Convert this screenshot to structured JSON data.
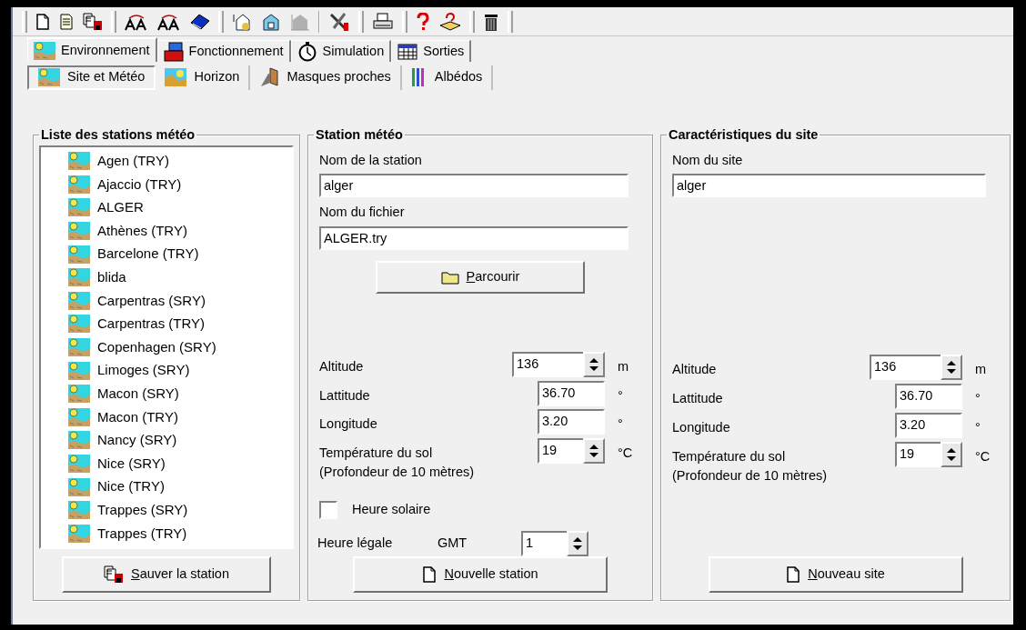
{
  "tabs": [
    {
      "label": "Environnement",
      "selected": true
    },
    {
      "label": "Fonctionnement",
      "selected": false
    },
    {
      "label": "Simulation",
      "selected": false
    },
    {
      "label": "Sorties",
      "selected": false
    }
  ],
  "subtabs": [
    {
      "label": "Site et Météo",
      "selected": true
    },
    {
      "label": "Horizon",
      "selected": false
    },
    {
      "label": "Masques proches",
      "selected": false
    },
    {
      "label": "Albédos",
      "selected": false
    }
  ],
  "stations_panel": {
    "title": "Liste des stations météo",
    "items": [
      {
        "label": "Agen (TRY)"
      },
      {
        "label": "Ajaccio (TRY)"
      },
      {
        "label": "ALGER"
      },
      {
        "label": "Athènes (TRY)"
      },
      {
        "label": "Barcelone (TRY)"
      },
      {
        "label": "blida"
      },
      {
        "label": "Carpentras (SRY)"
      },
      {
        "label": "Carpentras (TRY)"
      },
      {
        "label": "Copenhagen (SRY)"
      },
      {
        "label": "Limoges (SRY)"
      },
      {
        "label": "Macon (SRY)"
      },
      {
        "label": "Macon (TRY)"
      },
      {
        "label": "Nancy (SRY)"
      },
      {
        "label": "Nice (SRY)"
      },
      {
        "label": "Nice (TRY)"
      },
      {
        "label": "Trappes (SRY)"
      },
      {
        "label": "Trappes (TRY)"
      }
    ],
    "button": {
      "label": "Sauver la station"
    }
  },
  "station_panel": {
    "title": "Station météo",
    "fields": [
      {
        "label": "Nom de la station",
        "value": "alger"
      },
      {
        "label": "Nom du fichier",
        "value": "ALGER.try"
      }
    ],
    "browse_button": {
      "label": "Parcourir"
    },
    "params": [
      {
        "kind": "wide_spin",
        "label": "Altitude",
        "value": "136",
        "unit": "m"
      },
      {
        "kind": "field",
        "label": "Lattitude",
        "value": "36.70",
        "unit": "°"
      },
      {
        "kind": "field",
        "label": "Longitude",
        "value": "3.20",
        "unit": "°"
      },
      {
        "kind": "spin",
        "label": "Température du sol",
        "sublabel": "(Profondeur de 10 mètres)",
        "value": "19",
        "unit": "°C"
      }
    ],
    "solar_time": {
      "label": "Heure solaire",
      "checked": false
    },
    "legal_time": {
      "label": "Heure légale",
      "zone": "GMT",
      "value": "1"
    },
    "button": {
      "label": "Nouvelle station"
    }
  },
  "site_panel": {
    "title": "Caractéristiques du site",
    "fields": [
      {
        "label": "Nom du site",
        "value": "alger"
      }
    ],
    "params": [
      {
        "kind": "wide_spin",
        "label": "Altitude",
        "value": "136",
        "unit": "m"
      },
      {
        "kind": "field",
        "label": "Lattitude",
        "value": "36.70",
        "unit": "°"
      },
      {
        "kind": "field",
        "label": "Longitude",
        "value": "3.20",
        "unit": "°"
      },
      {
        "kind": "spin",
        "label": "Température du sol",
        "sublabel": "(Profondeur de 10 mètres)",
        "value": "19",
        "unit": "°C"
      }
    ],
    "button": {
      "label": "Nouveau site"
    }
  }
}
